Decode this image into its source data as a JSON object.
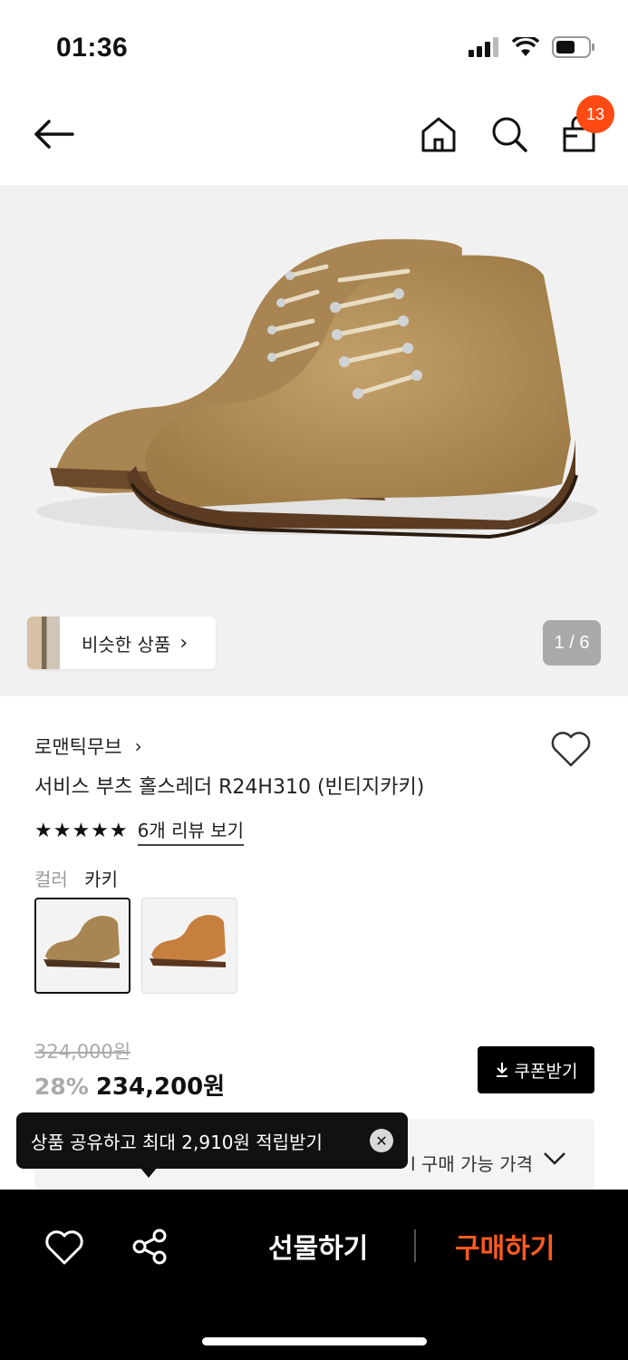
{
  "status": {
    "time": "01:36"
  },
  "nav": {
    "cart_count": "13"
  },
  "gallery": {
    "similar_label": "비슷한 상품",
    "counter": "1 / 6"
  },
  "product": {
    "brand": "로맨틱무브",
    "title": "서비스 부츠 홀스레더 R24H310 (빈티지카키)",
    "rating_stars": 5,
    "review_link": "6개 리뷰 보기",
    "color_label": "컬러",
    "color_value": "카키",
    "original_price": "324,000원",
    "discount": "28%",
    "price": "234,200원",
    "coupon_label": "쿠폰받기",
    "benefit_text": "l 구매 가능 가격"
  },
  "tooltip": {
    "text": "상품 공유하고 최대 2,910원 적립받기"
  },
  "bottom_bar": {
    "gift_label": "선물하기",
    "buy_label": "구매하기"
  },
  "colors": {
    "accent": "#ff5a1f",
    "badge": "#ff4b13"
  },
  "icons": [
    "back-arrow-icon",
    "home-icon",
    "search-icon",
    "shopping-bag-icon",
    "heart-icon",
    "share-icon",
    "download-icon",
    "chevron-down-icon",
    "close-icon"
  ]
}
